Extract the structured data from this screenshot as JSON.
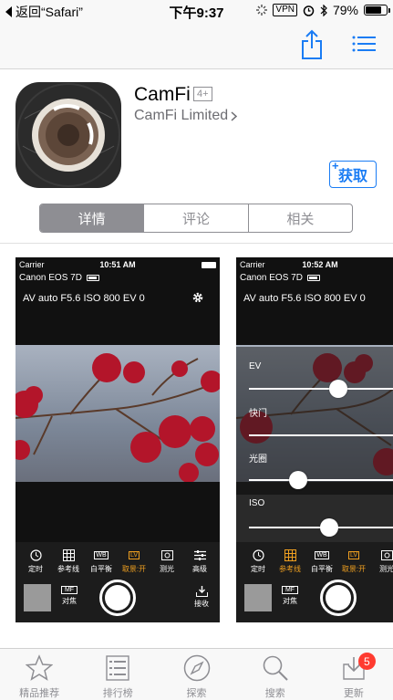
{
  "status_bar": {
    "back_label": "返回“Safari”",
    "time": "下午9:37",
    "vpn": "VPN",
    "battery": "79%",
    "battery_level": 0.79
  },
  "app": {
    "name": "CamFi",
    "age_rating": "4+",
    "developer": "CamFi Limited",
    "get_label": "获取",
    "get_plus": "+"
  },
  "segments": {
    "items": [
      "详情",
      "评论",
      "相关"
    ],
    "selected": "详情"
  },
  "screenshot1": {
    "carrier": "Carrier",
    "time": "10:51 AM",
    "camera": "Canon EOS 7D",
    "exposure": "AV  auto  F5.6  ISO 800  EV 0",
    "tools": [
      "定时",
      "参考线",
      "白平衡",
      "取景:开",
      "测光",
      "高级"
    ],
    "wb": "WB",
    "lv": "LV",
    "mf_box": "MF",
    "mf_label": "对焦",
    "download_label": "接收"
  },
  "screenshot2": {
    "carrier": "Carrier",
    "time": "10:52 AM",
    "camera": "Canon EOS 7D",
    "exposure": "AV  auto  F5.6  ISO 800  EV 0",
    "overlay": {
      "ev": "EV",
      "shutter": "快门",
      "aperture": "光圈",
      "iso": "ISO"
    },
    "tools": [
      "定时",
      "参考线",
      "白平衡",
      "取景:开",
      "测光"
    ],
    "wb": "WB",
    "lv": "LV",
    "mf_box": "MF",
    "mf_label": "对焦"
  },
  "tab_bar": {
    "items": [
      {
        "label": "精品推荐",
        "icon": "star-icon"
      },
      {
        "label": "排行榜",
        "icon": "list-icon"
      },
      {
        "label": "探索",
        "icon": "compass-icon"
      },
      {
        "label": "搜索",
        "icon": "search-icon"
      },
      {
        "label": "更新",
        "icon": "download-icon"
      }
    ],
    "updates_badge": "5"
  },
  "colors": {
    "accent": "#1a7cf4",
    "badge": "#ff3b30",
    "camera_orange": "#f0a020"
  }
}
